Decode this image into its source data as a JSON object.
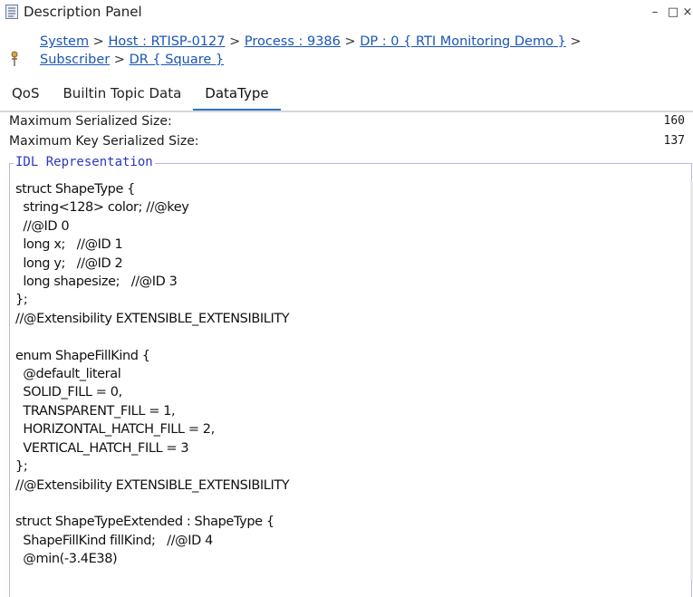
{
  "window": {
    "title": "Description Panel",
    "minimize": "–",
    "maximize": "□",
    "close": "×"
  },
  "breadcrumb": {
    "items": [
      "System",
      "Host : RTISP-0127",
      "Process : 9386",
      "DP : 0 { RTI Monitoring Demo }",
      "Subscriber",
      "DR { Square }"
    ],
    "separator": " > "
  },
  "tabs": [
    {
      "label": "QoS",
      "active": false
    },
    {
      "label": "Builtin Topic Data",
      "active": false
    },
    {
      "label": "DataType",
      "active": true
    }
  ],
  "properties": [
    {
      "label": "Maximum Serialized Size:",
      "value": "160"
    },
    {
      "label": "Maximum Key Serialized Size:",
      "value": "137"
    }
  ],
  "idl": {
    "legend": "IDL Representation",
    "code": "struct ShapeType {\n  string<128> color; //@key\n  //@ID 0\n  long x;   //@ID 1\n  long y;   //@ID 2\n  long shapesize;   //@ID 3\n};\n//@Extensibility EXTENSIBLE_EXTENSIBILITY\n\nenum ShapeFillKind {\n  @default_literal\n  SOLID_FILL = 0,\n  TRANSPARENT_FILL = 1,\n  HORIZONTAL_HATCH_FILL = 2,\n  VERTICAL_HATCH_FILL = 3\n};\n//@Extensibility EXTENSIBLE_EXTENSIBILITY\n\nstruct ShapeTypeExtended : ShapeType {\n  ShapeFillKind fillKind;   //@ID 4\n  @min(-3.4E38)"
  },
  "colors": {
    "link": "#1a55b8",
    "tab_indicator": "#2a76c6",
    "legend": "#2b36c2",
    "box_border": "#b7b7ee"
  },
  "icons": [
    "document-icon",
    "pin-icon",
    "minimize-icon",
    "maximize-icon",
    "close-icon"
  ]
}
